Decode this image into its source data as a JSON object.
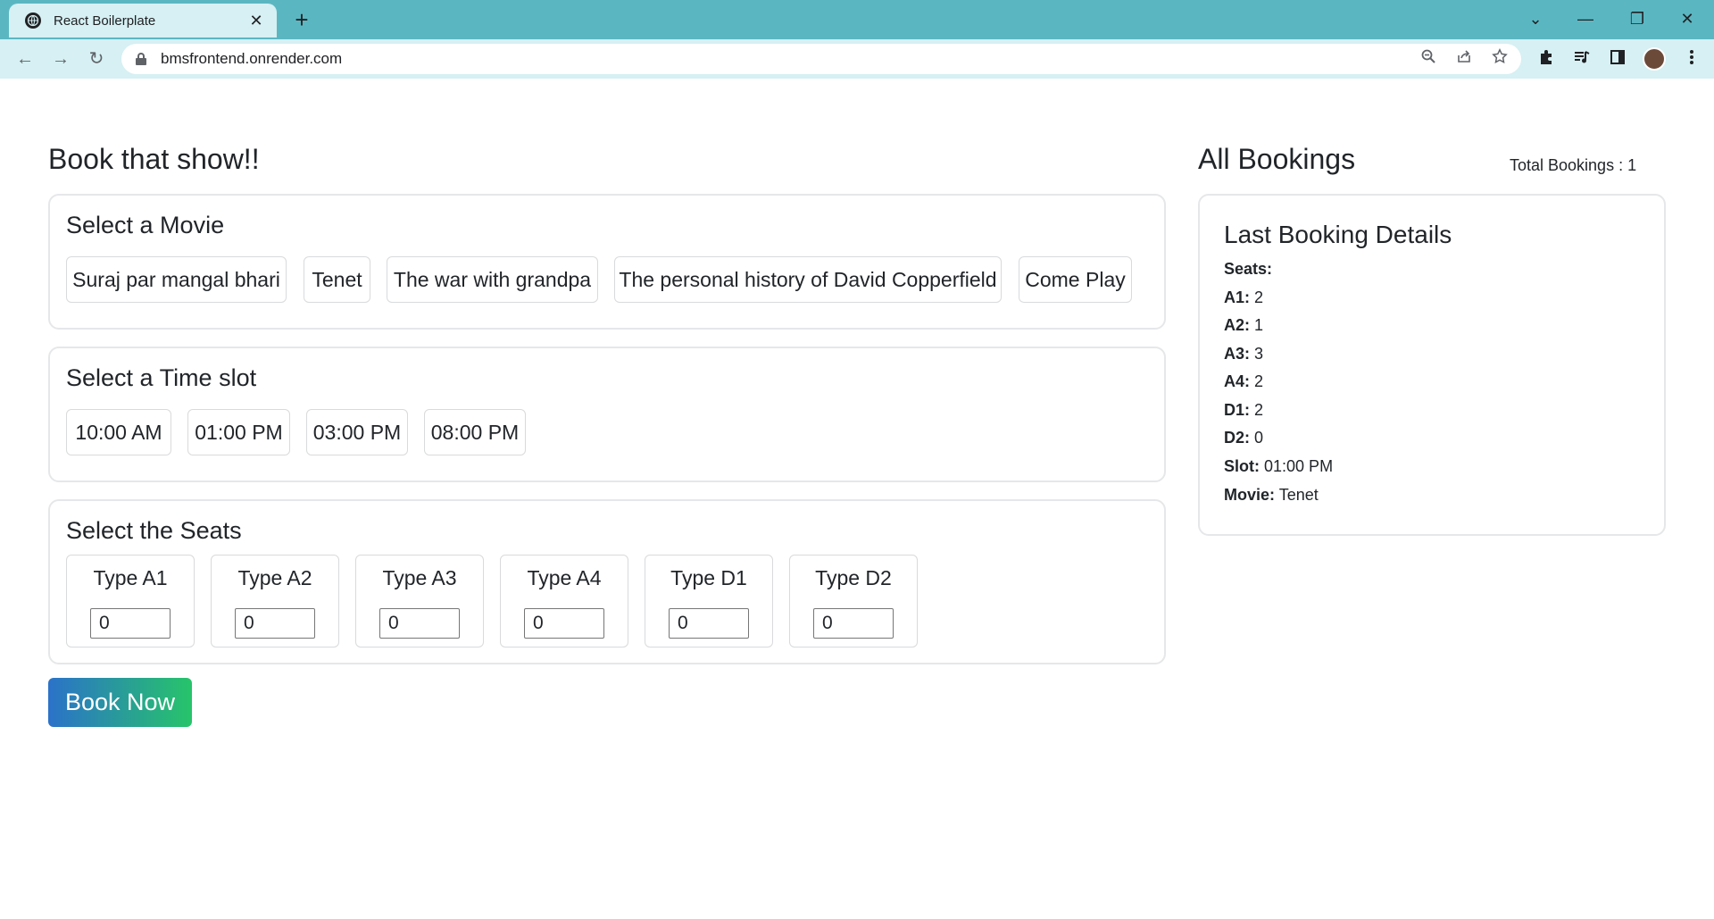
{
  "browser": {
    "tab_title": "React Boilerplate",
    "tab_close": "✕",
    "new_tab": "+",
    "url": "bmsfrontend.onrender.com",
    "window_controls": {
      "dropdown": "⌄",
      "minimize": "—",
      "restore": "❐",
      "close": "✕"
    },
    "nav": {
      "back": "←",
      "forward": "→",
      "reload": "↻"
    },
    "icons": [
      "zoom-icon",
      "share-icon",
      "star-icon",
      "extensions-icon",
      "media-icon",
      "sidepanel-icon",
      "profile-avatar",
      "menu-icon"
    ]
  },
  "booking": {
    "heading": "Book that show!!",
    "movie_card": {
      "title": "Select a Movie",
      "movies": [
        "Suraj par mangal bhari",
        "Tenet",
        "The war with grandpa",
        "The personal history of David Copperfield",
        "Come Play"
      ]
    },
    "slot_card": {
      "title": "Select a Time slot",
      "slots": [
        "10:00 AM",
        "01:00 PM",
        "03:00 PM",
        "08:00 PM"
      ]
    },
    "seat_card": {
      "title": "Select the Seats",
      "seats": [
        {
          "label": "Type A1",
          "value": "0"
        },
        {
          "label": "Type A2",
          "value": "0"
        },
        {
          "label": "Type A3",
          "value": "0"
        },
        {
          "label": "Type A4",
          "value": "0"
        },
        {
          "label": "Type D1",
          "value": "0"
        },
        {
          "label": "Type D2",
          "value": "0"
        }
      ]
    },
    "book_button": "Book Now"
  },
  "all_bookings": {
    "heading": "All Bookings",
    "total": "Total Bookings : 1",
    "last_booking": {
      "title": "Last Booking Details",
      "seats_label": "Seats:",
      "rows": [
        {
          "key": "A1:",
          "value": "2"
        },
        {
          "key": "A2:",
          "value": "1"
        },
        {
          "key": "A3:",
          "value": "3"
        },
        {
          "key": "A4:",
          "value": "2"
        },
        {
          "key": "D1:",
          "value": "2"
        },
        {
          "key": "D2:",
          "value": "0"
        },
        {
          "key": "Slot:",
          "value": "01:00 PM"
        },
        {
          "key": "Movie:",
          "value": "Tenet"
        }
      ]
    }
  },
  "colors": {
    "chrome_accent": "#5ab7c2",
    "toolbar_bg": "#d6f0f3",
    "button_gradient_start": "#2b72c9",
    "button_gradient_end": "#27c46a",
    "card_border": "#e6e7e9"
  }
}
